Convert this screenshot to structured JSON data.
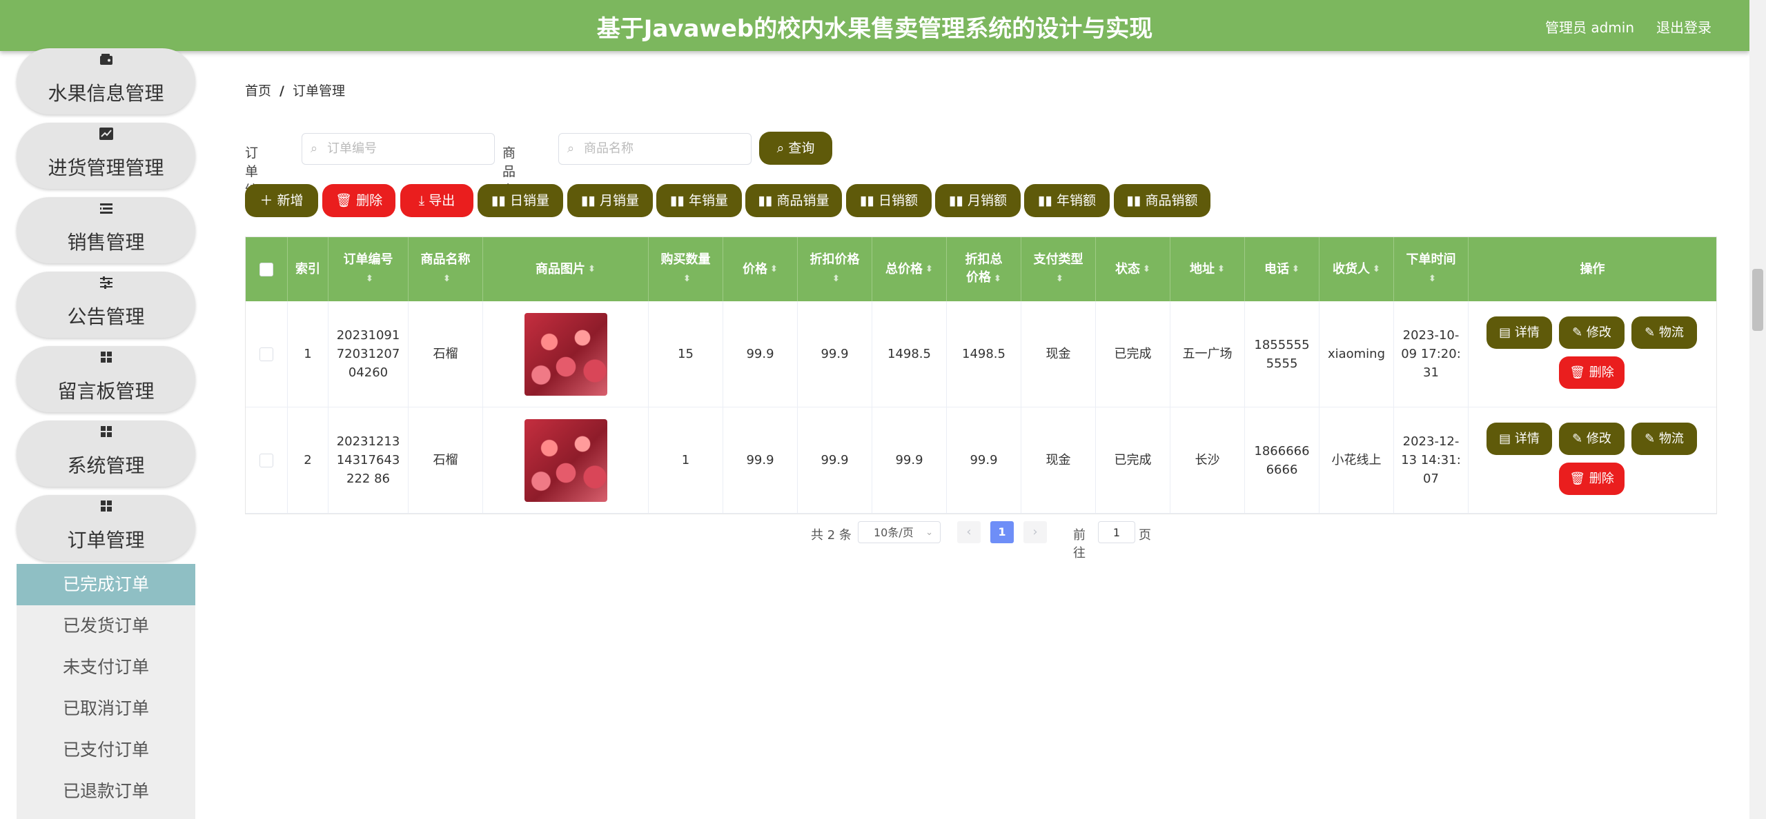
{
  "header": {
    "title": "基于Javaweb的校内水果售卖管理系统的设计与实现",
    "user": "管理员 admin",
    "logout": "退出登录"
  },
  "sidebar": {
    "items": [
      {
        "label": "水果信息管理",
        "icon": "wallet-icon"
      },
      {
        "label": "进货管理管理",
        "icon": "trend-chart-icon"
      },
      {
        "label": "销售管理",
        "icon": "list-icon"
      },
      {
        "label": "公告管理",
        "icon": "sliders-icon"
      },
      {
        "label": "留言板管理",
        "icon": "grid-icon"
      },
      {
        "label": "系统管理",
        "icon": "grid-icon"
      },
      {
        "label": "订单管理",
        "icon": "grid-icon"
      }
    ],
    "submenu": [
      "已完成订单",
      "已发货订单",
      "未支付订单",
      "已取消订单",
      "已支付订单",
      "已退款订单"
    ],
    "active_submenu": "已完成订单"
  },
  "breadcrumb": {
    "home": "首页",
    "sep": "/",
    "current": "订单管理"
  },
  "search": {
    "order_no_label": "订单编号",
    "order_no_placeholder": "订单编号",
    "product_label": "商品名称",
    "product_placeholder": "商品名称",
    "query_btn": "查询"
  },
  "toolbar": {
    "add": "新增",
    "delete": "删除",
    "export": "导出",
    "daily_volume": "日销量",
    "monthly_volume": "月销量",
    "yearly_volume": "年销量",
    "product_volume": "商品销量",
    "daily_amount": "日销额",
    "monthly_amount": "月销额",
    "yearly_amount": "年销额",
    "product_amount": "商品销额"
  },
  "table": {
    "columns": [
      "索引",
      "订单编号",
      "商品名称",
      "商品图片",
      "购买数量",
      "价格",
      "折扣价格",
      "总价格",
      "折扣总价格",
      "支付类型",
      "状态",
      "地址",
      "电话",
      "收货人",
      "下单时间",
      "操作"
    ],
    "rows": [
      {
        "index": "1",
        "order_no": "202310917203120704260",
        "product": "石榴",
        "qty": "15",
        "price": "99.9",
        "discount_price": "99.9",
        "total": "1498.5",
        "discount_total": "1498.5",
        "pay_type": "现金",
        "status": "已完成",
        "address": "五一广场",
        "phone": "18555555555",
        "receiver": "xiaoming",
        "time": "2023-10-09 17:20:31"
      },
      {
        "index": "2",
        "order_no": "2023121314317643222 86",
        "product": "石榴",
        "qty": "1",
        "price": "99.9",
        "discount_price": "99.9",
        "total": "99.9",
        "discount_total": "99.9",
        "pay_type": "现金",
        "status": "已完成",
        "address": "长沙",
        "phone": "18666666666",
        "receiver": "小花线上",
        "time": "2023-12-13 14:31:07"
      }
    ],
    "row_actions": {
      "detail": "详情",
      "edit": "修改",
      "logistics": "物流",
      "delete": "删除"
    }
  },
  "pagination": {
    "total": "共 2 条",
    "page_size": "10条/页",
    "current_page": "1",
    "goto_label": "前往",
    "goto_value": "1",
    "goto_suffix": "页"
  }
}
